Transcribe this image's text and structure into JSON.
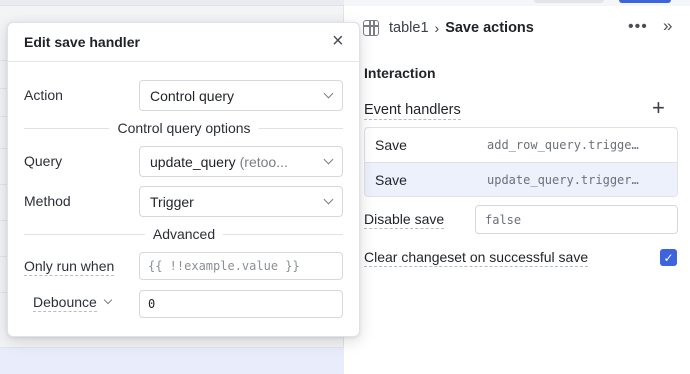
{
  "inspector": {
    "breadcrumb_component": "table1",
    "breadcrumb_separator": "›",
    "breadcrumb_current": "Save actions",
    "more_icon": "•••",
    "collapse_icon": "»",
    "section_title": "Interaction",
    "event_handlers_label": "Event handlers",
    "add_icon": "+",
    "event_handlers": [
      {
        "event": "Save",
        "target": "add_row_query.trigger()"
      },
      {
        "event": "Save",
        "target": "update_query.trigger()"
      }
    ],
    "disable_save_label": "Disable save",
    "disable_save_value": "false",
    "clear_changeset_label": "Clear changeset on successful save",
    "clear_changeset_checked": true,
    "check_mark": "✓"
  },
  "modal": {
    "title": "Edit save handler",
    "close_icon": "×",
    "action_label": "Action",
    "action_value": "Control query",
    "control_query_options_heading": "Control query options",
    "query_label": "Query",
    "query_value": "update_query",
    "query_value_sub": "(retoo...",
    "method_label": "Method",
    "method_value": "Trigger",
    "advanced_heading": "Advanced",
    "only_run_when_label": "Only run when",
    "only_run_when_placeholder": "{{ !!example.value }}",
    "debounce_label": "Debounce",
    "debounce_value": "0"
  },
  "colors": {
    "accent": "#3d63dd",
    "selected_row": "#edf1fc"
  }
}
